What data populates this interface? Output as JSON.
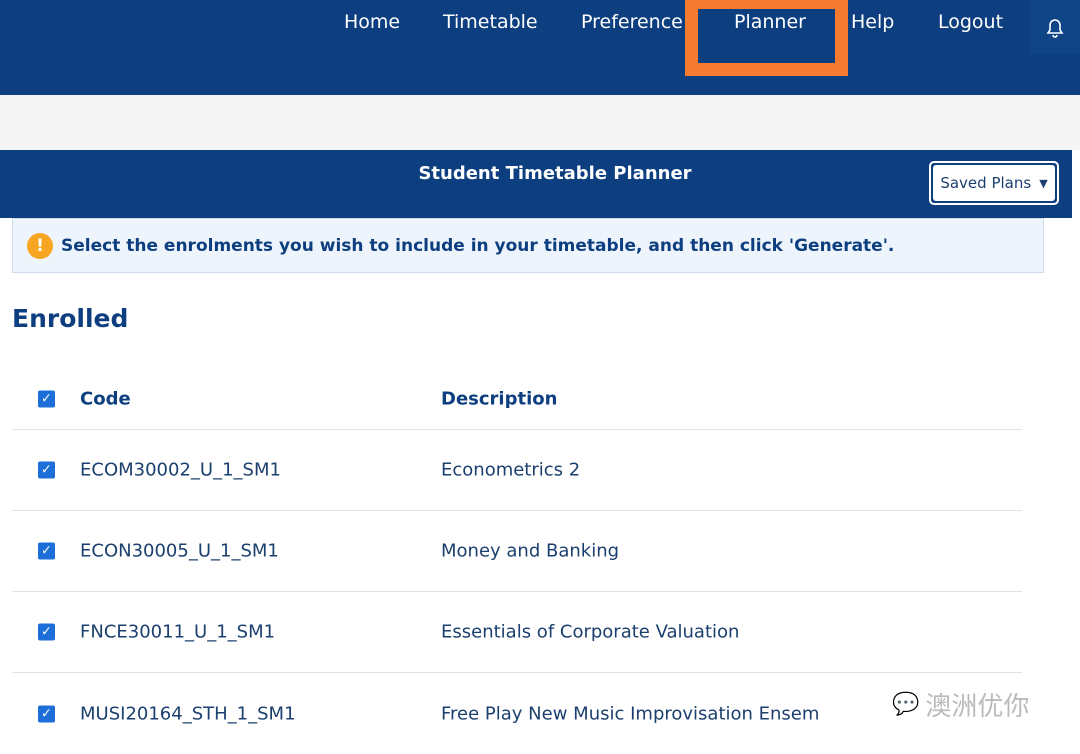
{
  "nav": {
    "items": [
      "Home",
      "Timetable",
      "Preference",
      "Planner",
      "Help",
      "Logout"
    ],
    "active": "Planner",
    "bell_icon": "bell-icon"
  },
  "planner": {
    "title": "Student Timetable Planner",
    "saved_plans": "Saved Plans"
  },
  "alert": {
    "text": "Select the enrolments you wish to include in your timetable, and then click 'Generate'."
  },
  "enrolled": {
    "heading": "Enrolled",
    "columns": {
      "code": "Code",
      "description": "Description"
    },
    "rows": [
      {
        "code": "ECOM30002_U_1_SM1",
        "description": "Econometrics 2",
        "checked": true
      },
      {
        "code": "ECON30005_U_1_SM1",
        "description": "Money and Banking",
        "checked": true
      },
      {
        "code": "FNCE30011_U_1_SM1",
        "description": "Essentials of Corporate Valuation",
        "checked": true
      },
      {
        "code": "MUSI20164_STH_1_SM1",
        "description": "Free Play New Music Improvisation Ensem",
        "checked": true
      }
    ]
  },
  "watermark": "澳洲优你",
  "colors": {
    "nav": "#0d3f80",
    "highlight": "#f47b30",
    "checkbox": "#1d6ed8",
    "warning": "#f6a623"
  }
}
